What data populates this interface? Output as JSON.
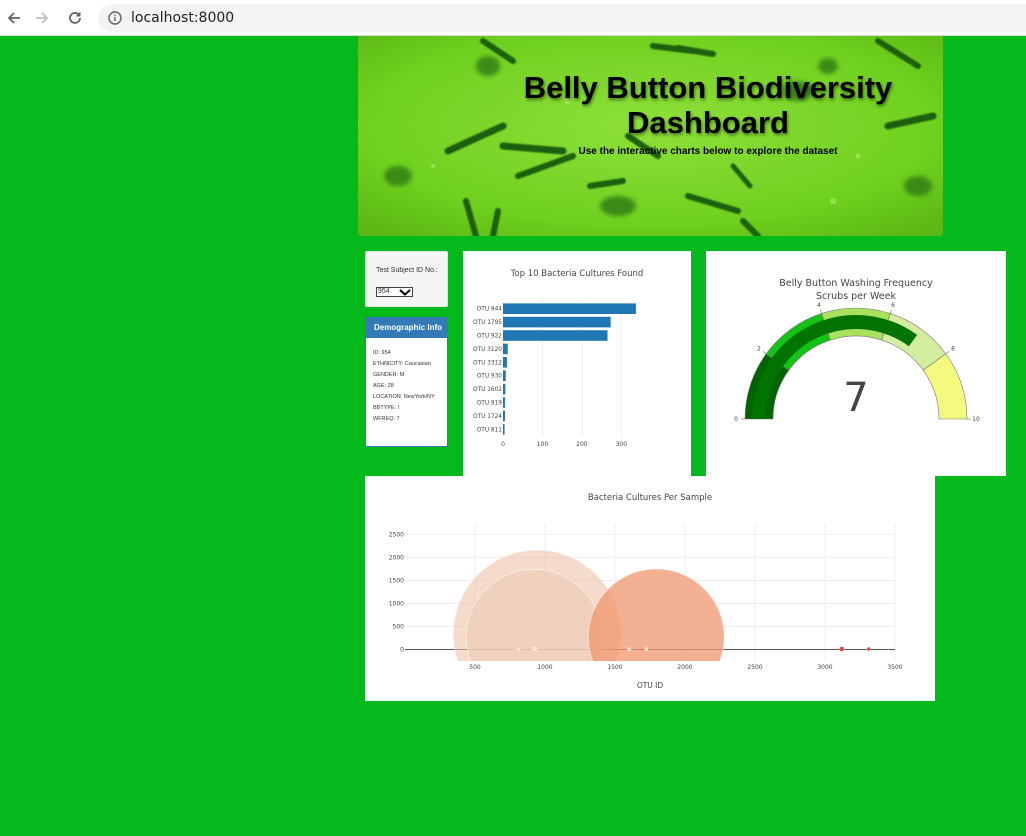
{
  "browser": {
    "url": "localhost:8000"
  },
  "header": {
    "title": "Belly Button Biodiversity Dashboard",
    "subtitle": "Use the interactive charts below to explore the dataset"
  },
  "selector": {
    "label": "Test Subject ID No.:",
    "value": "954"
  },
  "demographics": {
    "heading": "Demographic Info",
    "rows": [
      "ID: 954",
      "ETHNICITY: Caucasian",
      "GENDER: M",
      "AGE: 28",
      "LOCATION: NewYork/NY",
      "BBTYPE: I",
      "WFREQ: 7"
    ]
  },
  "chart_data": [
    {
      "type": "bar",
      "orientation": "horizontal",
      "title": "Top 10 Bacteria Cultures Found",
      "categories": [
        "OTU 944",
        "OTU 1795",
        "OTU 922",
        "OTU 3120",
        "OTU 3312",
        "OTU 930",
        "OTU 1602",
        "OTU 919",
        "OTU 1724",
        "OTU 811"
      ],
      "values": [
        337,
        273,
        265,
        12,
        10,
        7,
        6,
        5,
        5,
        4
      ],
      "xticks": [
        0,
        100,
        200,
        300
      ],
      "xlim": [
        0,
        355
      ],
      "color": "#1f77b4"
    },
    {
      "type": "gauge",
      "title": "Belly Button Washing Frequency",
      "subtitle": "Scrubs per Week",
      "value": 7,
      "range": [
        0,
        10
      ],
      "ticks": [
        0,
        2,
        4,
        6,
        8,
        10
      ],
      "steps": [
        {
          "range": [
            0,
            2
          ],
          "color": "#006400"
        },
        {
          "range": [
            2,
            4
          ],
          "color": "#14c414"
        },
        {
          "range": [
            4,
            6
          ],
          "color": "#a9e05c"
        },
        {
          "range": [
            6,
            8
          ],
          "color": "#d3ee9f"
        },
        {
          "range": [
            8,
            10
          ],
          "color": "#f4fa7d"
        }
      ],
      "bar_color": "#007300"
    },
    {
      "type": "bubble",
      "title": "Bacteria Cultures Per Sample",
      "xlabel": "OTU ID",
      "xticks": [
        500,
        1000,
        1500,
        2000,
        2500,
        3000,
        3500
      ],
      "yticks": [
        0,
        500,
        1000,
        1500,
        2000,
        2500
      ],
      "xlim": [
        0,
        3500
      ],
      "ylim": [
        -250,
        2900
      ],
      "points": [
        {
          "x": 944,
          "y": 337,
          "r": 84,
          "color": "rgba(236,190,160,0.55)"
        },
        {
          "x": 922,
          "y": 265,
          "r": 68,
          "color": "rgba(238,205,185,0.75)"
        },
        {
          "x": 1795,
          "y": 273,
          "r": 68,
          "color": "rgba(240,150,110,0.75)"
        },
        {
          "x": 3120,
          "y": 12,
          "r": 2.5,
          "color": "#d44b3c"
        },
        {
          "x": 3312,
          "y": 10,
          "r": 2,
          "color": "#d44b3c"
        },
        {
          "x": 930,
          "y": 7,
          "r": 1.5,
          "color": "#f0d9cd"
        },
        {
          "x": 1602,
          "y": 6,
          "r": 1.5,
          "color": "#f0d9cd"
        },
        {
          "x": 919,
          "y": 5,
          "r": 1.5,
          "color": "#f0d9cd"
        },
        {
          "x": 1724,
          "y": 5,
          "r": 1.5,
          "color": "#f0d9cd"
        },
        {
          "x": 811,
          "y": 4,
          "r": 1.5,
          "color": "#f0d9cd"
        }
      ]
    }
  ]
}
